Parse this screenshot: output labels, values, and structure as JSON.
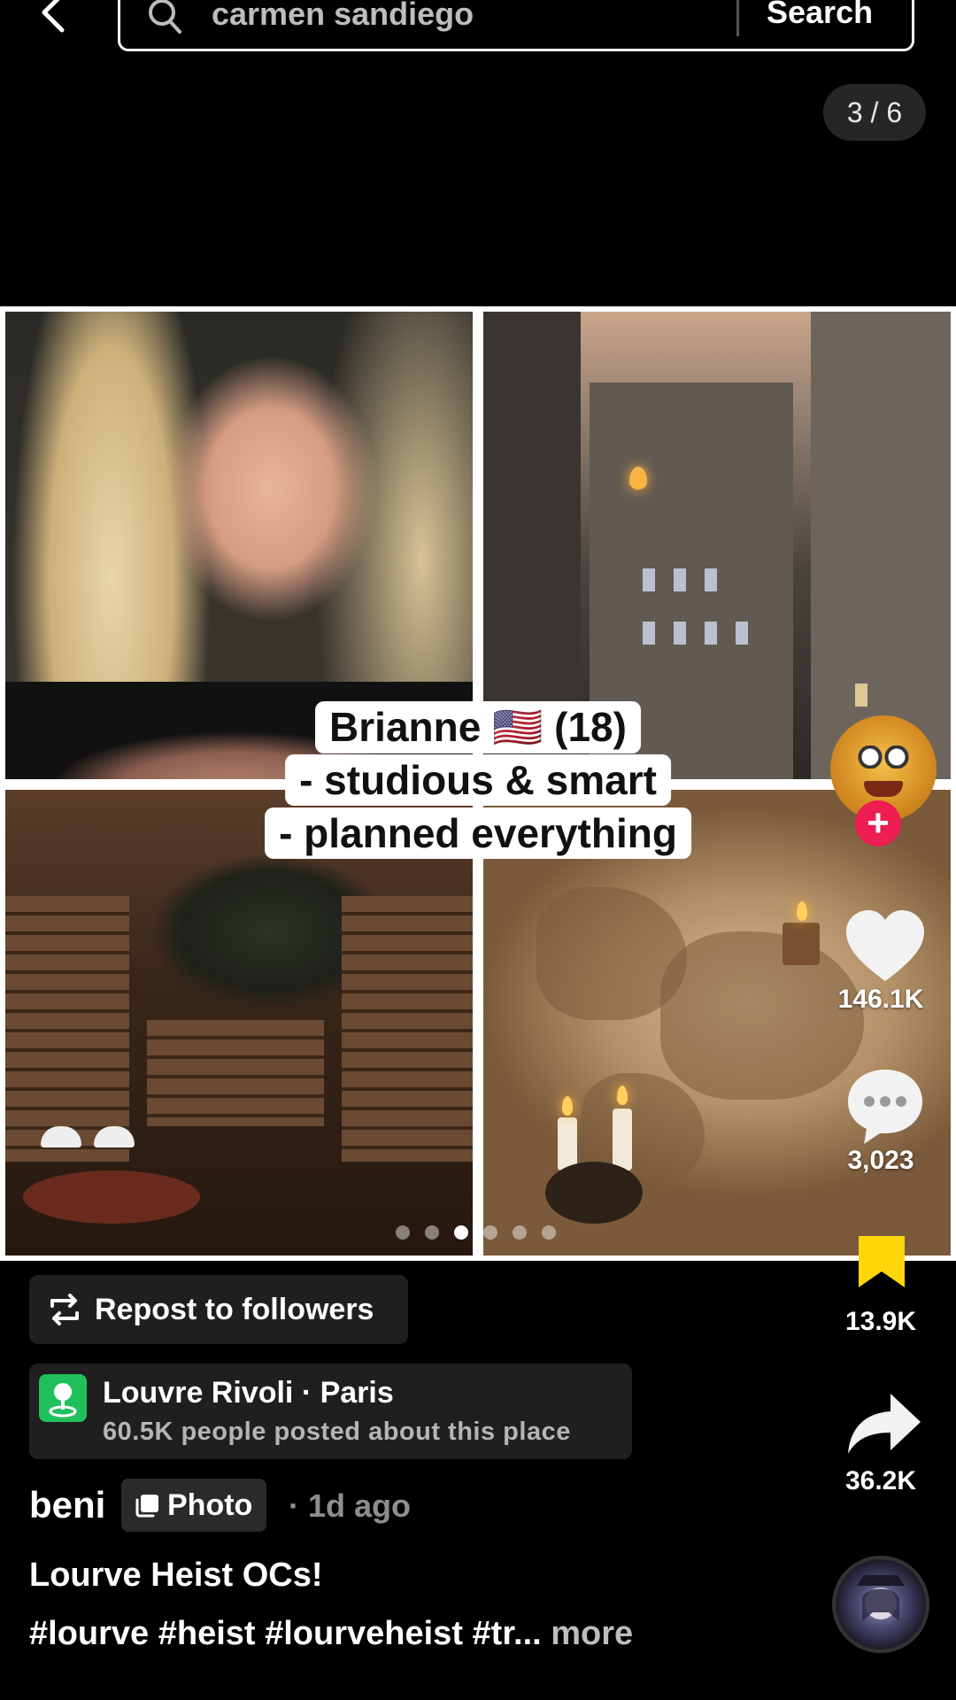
{
  "search": {
    "query": "carmen sandiego",
    "button_label": "Search"
  },
  "page_counter": "3 / 6",
  "caption": {
    "line1": "Brianne 🇺🇸 (18)",
    "line2": "- studious & smart",
    "line3": "- planned everything"
  },
  "carousel": {
    "total_dots": 6,
    "active_index": 2
  },
  "rail": {
    "likes": "146.1K",
    "comments": "3,023",
    "saves": "13.9K",
    "shares": "36.2K"
  },
  "repost_label": "Repost to followers",
  "place": {
    "name": "Louvre Rivoli · Paris",
    "subtitle": "60.5K people posted about this place"
  },
  "post": {
    "author": "beni",
    "type_label": "Photo",
    "time": "· 1d ago",
    "title": "Lourve Heist OCs!",
    "hashtags": "#lourve #heist #lourveheist #tr...",
    "more_label": "more"
  },
  "colors": {
    "follow": "#ee1d52",
    "bookmark": "#ffd60a",
    "place_icon": "#20c15c"
  }
}
